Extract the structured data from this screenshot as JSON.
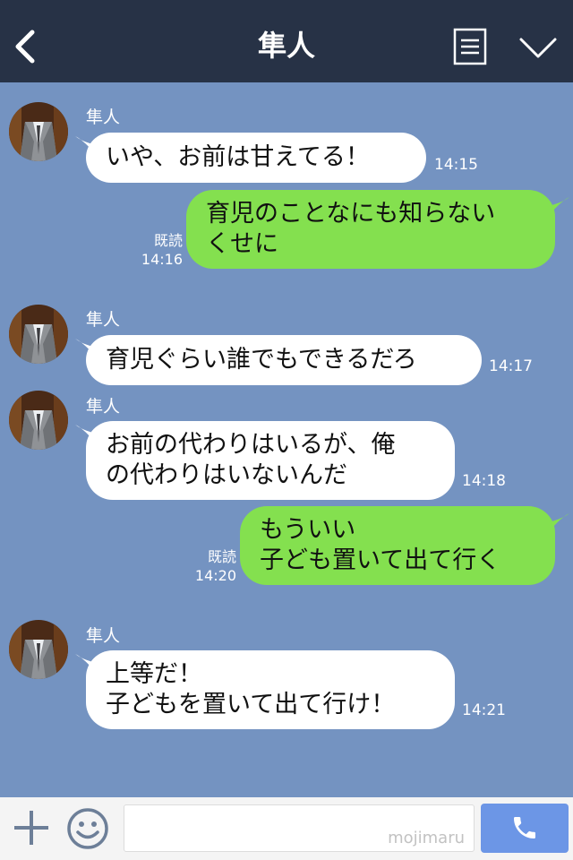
{
  "header": {
    "title": "隼人"
  },
  "messages": [
    {
      "sender": "隼人",
      "lines": [
        "いや、お前は甘えてる！"
      ],
      "time": "14:15"
    },
    {
      "read": "既読",
      "lines": [
        "育児のことなにも知らない",
        "くせに"
      ],
      "time": "14:16"
    },
    {
      "sender": "隼人",
      "lines": [
        "育児ぐらい誰でもできるだろ"
      ],
      "time": "14:17"
    },
    {
      "sender": "隼人",
      "lines": [
        "お前の代わりはいるが、俺",
        "の代わりはいないんだ"
      ],
      "time": "14:18"
    },
    {
      "read": "既読",
      "lines": [
        "もういい",
        "子ども置いて出て行く"
      ],
      "time": "14:20"
    },
    {
      "sender": "隼人",
      "lines": [
        "上等だ！",
        "子どもを置いて出て行け！"
      ],
      "time": "14:21"
    }
  ],
  "footer": {
    "watermark": "mojimaru"
  },
  "colors": {
    "header_bg": "#273246",
    "chat_bg": "#7493c1",
    "outgoing_bubble": "#84e04f",
    "incoming_bubble": "#ffffff",
    "call_button": "#6c96e6"
  },
  "icons": [
    "back-arrow-icon",
    "menu-icon",
    "chevron-down-icon",
    "avatar",
    "plus-icon",
    "smile-icon",
    "phone-icon"
  ]
}
